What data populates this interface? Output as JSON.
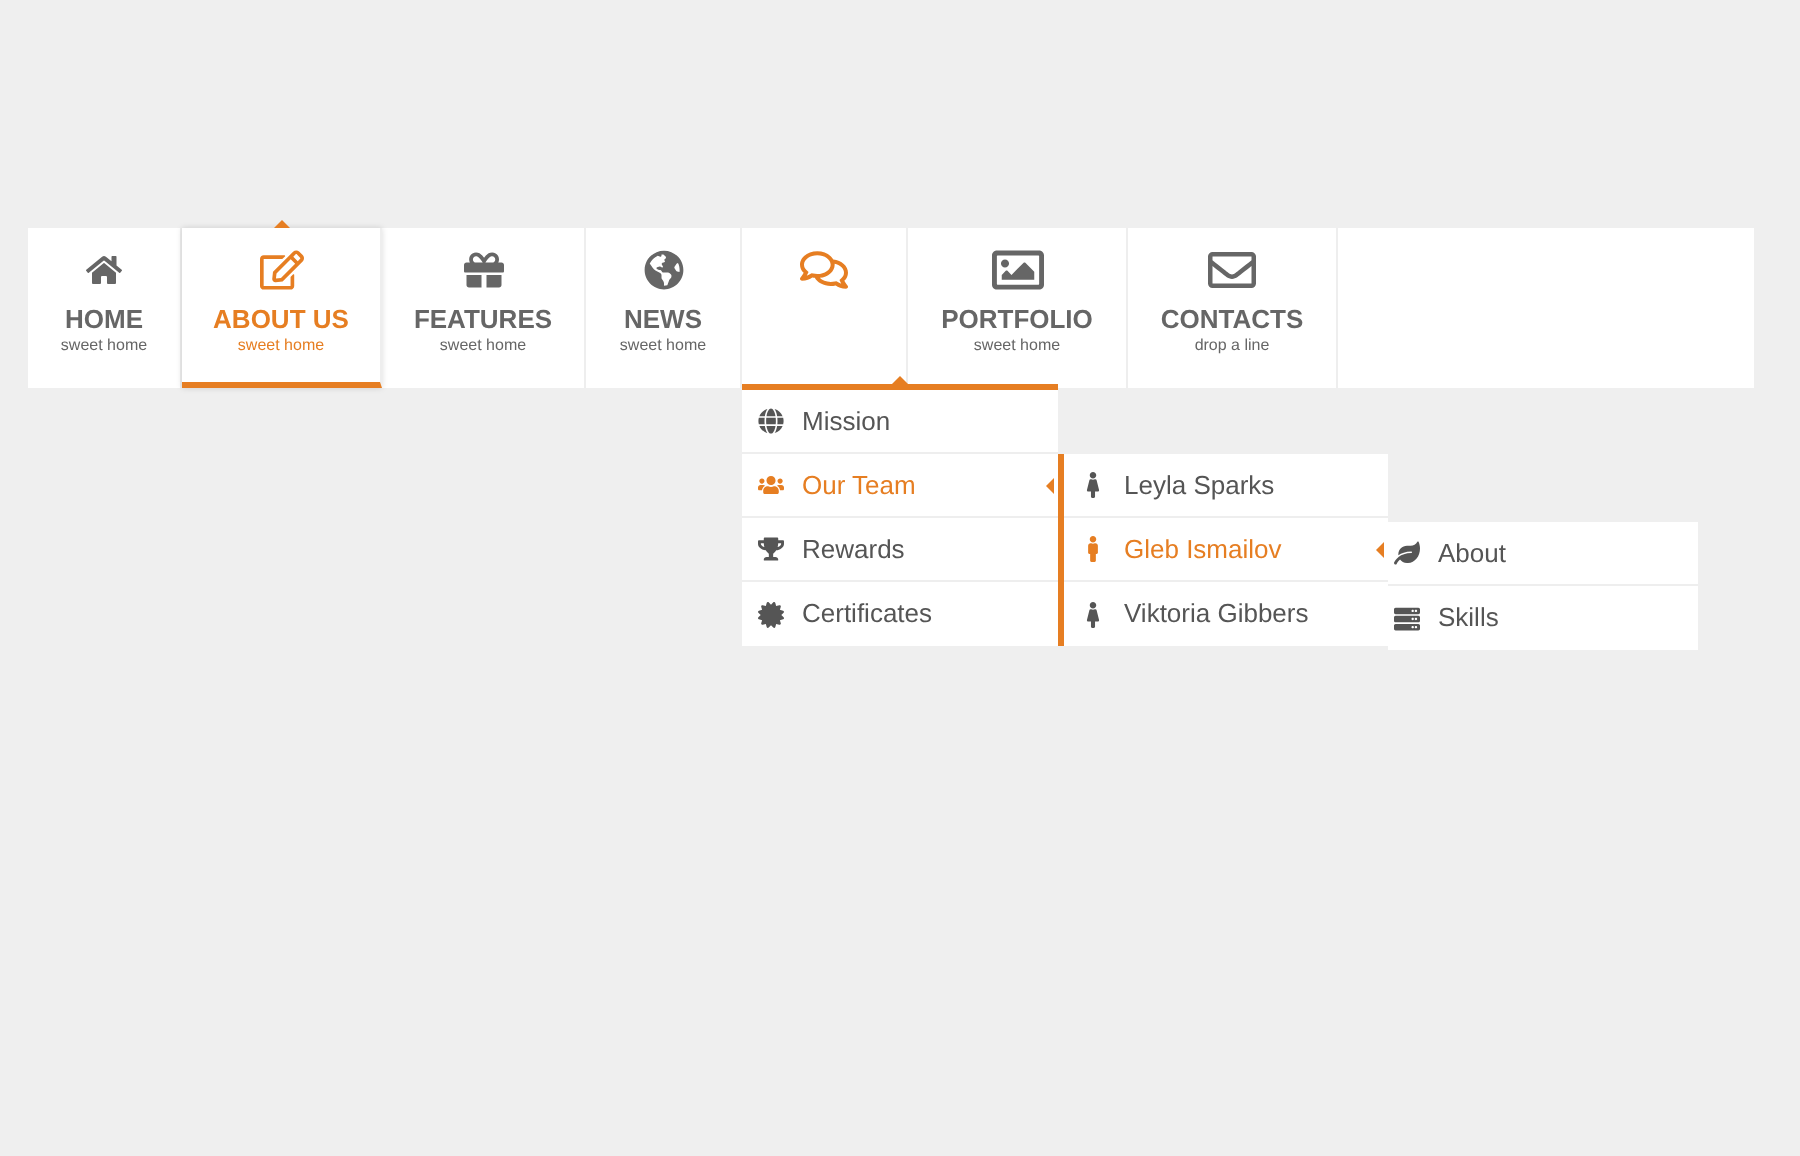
{
  "nav": [
    {
      "label": "HOME",
      "sublabel": "sweet home",
      "selected": false,
      "expanded": false
    },
    {
      "label": "ABOUT US",
      "sublabel": "sweet home",
      "selected": true,
      "expanded": false
    },
    {
      "label": "FEATURES",
      "sublabel": "sweet home",
      "selected": false,
      "expanded": false
    },
    {
      "label": "NEWS",
      "sublabel": "sweet home",
      "selected": false,
      "expanded": false
    },
    {
      "selected": false,
      "expanded": true,
      "menu": [
        {
          "label": "Mission",
          "expanded": false
        },
        {
          "label": "Our Team",
          "expanded": true,
          "children": [
            {
              "label": "Leyla Sparks",
              "expanded": false
            },
            {
              "label": "Gleb Ismailov",
              "expanded": true,
              "children": [
                {
                  "label": "About"
                },
                {
                  "label": "Skills"
                }
              ]
            },
            {
              "label": "Viktoria Gibbers",
              "expanded": false
            }
          ]
        },
        {
          "label": "Rewards",
          "expanded": false
        },
        {
          "label": "Certificates",
          "expanded": false
        }
      ]
    },
    {
      "label": "PORTFOLIO",
      "sublabel": "sweet home",
      "selected": false,
      "expanded": false
    },
    {
      "label": "CONTACTS",
      "sublabel": "drop a line",
      "selected": false,
      "expanded": false
    }
  ]
}
